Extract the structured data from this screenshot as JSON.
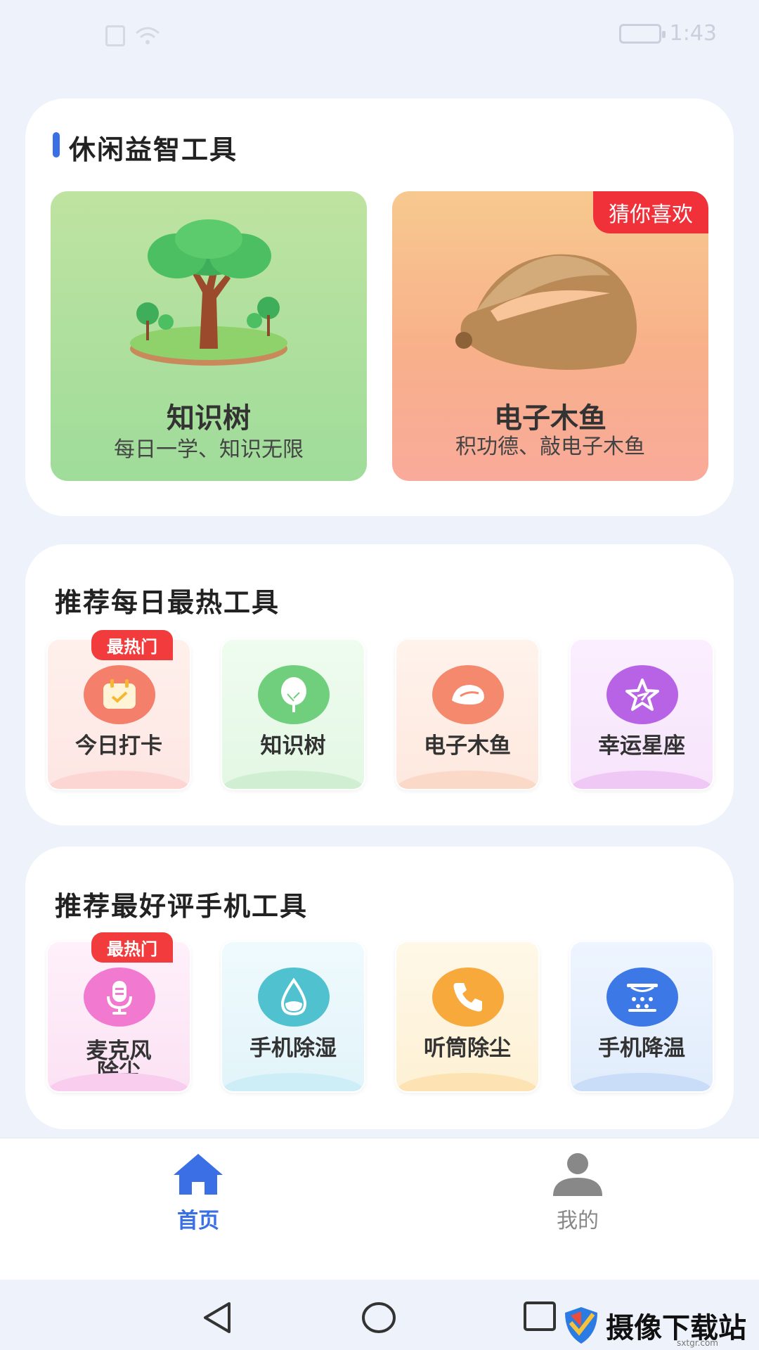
{
  "status_bar": {
    "time": "1:43"
  },
  "leisure": {
    "title": "休闲益智工具",
    "items": [
      {
        "name": "知识树",
        "subtitle": "每日一学、知识无限"
      },
      {
        "name": "电子木鱼",
        "subtitle": "积功德、敲电子木鱼",
        "tag": "猜你喜欢"
      }
    ]
  },
  "daily_hot": {
    "title": "推荐每日最热工具",
    "tag": "最热门",
    "items": [
      {
        "label": "今日打卡",
        "icon": "calendar-check-icon",
        "color": "#f47f6b"
      },
      {
        "label": "知识树",
        "icon": "tree-icon",
        "color": "#6fcf7d"
      },
      {
        "label": "电子木鱼",
        "icon": "wooden-fish-icon",
        "color": "#f4896d"
      },
      {
        "label": "幸运星座",
        "icon": "star-icon",
        "color": "#b863e6"
      }
    ]
  },
  "top_rated": {
    "title": "推荐最好评手机工具",
    "tag": "最热门",
    "items": [
      {
        "label_line1": "麦克风",
        "label_line2": "除尘",
        "icon": "microphone-icon",
        "color": "#f279d0"
      },
      {
        "label": "手机除湿",
        "icon": "water-drop-icon",
        "color": "#4fc1cf"
      },
      {
        "label": "听筒除尘",
        "icon": "phone-icon",
        "color": "#f7a93b"
      },
      {
        "label": "手机降温",
        "icon": "cooling-icon",
        "color": "#3d79e6"
      }
    ]
  },
  "bottom_nav": {
    "items": [
      {
        "label": "首页",
        "icon": "home-icon",
        "active": true
      },
      {
        "label": "我的",
        "icon": "user-icon",
        "active": false
      }
    ]
  },
  "watermark": {
    "text": "摄像下载站",
    "url": "sxtgr.com"
  },
  "colors": {
    "accent": "#3b6fe6",
    "hot_tag": "#f0313a",
    "inactive": "#888888"
  }
}
